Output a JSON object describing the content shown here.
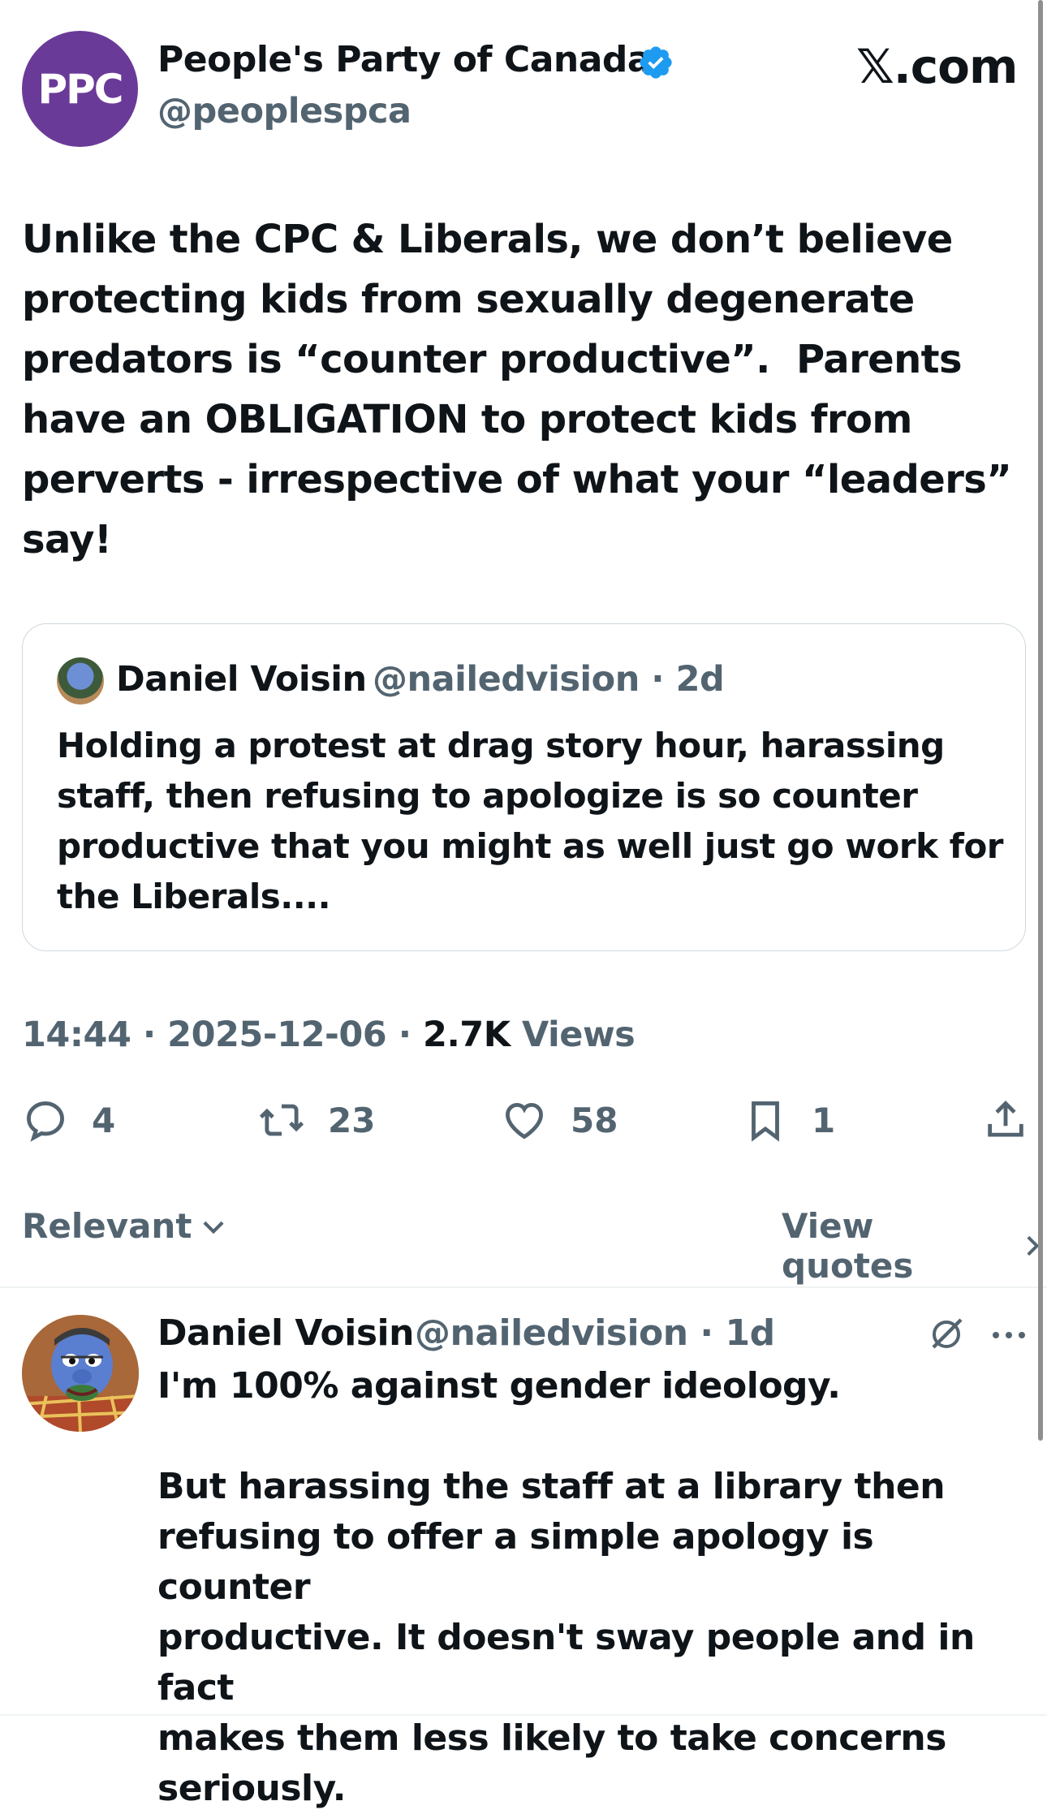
{
  "header": {
    "avatar_text": "PPC",
    "author_name": "People's Party of Canada",
    "handle": "@peoplespca",
    "site": "𝕏.com"
  },
  "tweet": {
    "text": "Unlike the CPC & Liberals, we don’t believe\nprotecting kids from sexually degenerate\npredators is “counter productive”.  Parents\nhave an OBLIGATION to protect kids from\nperverts - irrespective of what your “leaders”\nsay!"
  },
  "quote": {
    "name": "Daniel Voisin",
    "handle_time": "@nailedvision · 2d",
    "text": "Holding a protest at drag story hour, harassing\nstaff, then refusing to apologize is so counter\nproductive that you might as well just go work for\nthe Liberals...."
  },
  "meta": {
    "time": "14:44",
    "date": "2025-12-06",
    "views_count": "2.7K",
    "views_label": "Views"
  },
  "actions": {
    "replies": "4",
    "reposts": "23",
    "likes": "58",
    "bookmarks": "1"
  },
  "sort": {
    "relevant_label": "Relevant",
    "view_quotes_label": "View quotes"
  },
  "reply": {
    "name": "Daniel Voisin",
    "handle_time": "@nailedvision · 1d",
    "text": "I'm 100% against gender ideology.\n\nBut harassing the staff at a library then\nrefusing to offer a simple apology is counter\nproductive. It doesn't sway people and in fact\nmakes them less likely to take concerns\nseriously."
  },
  "colors": {
    "ppc_purple": "#6a3a99",
    "verified_blue": "#1d9bf0",
    "secondary_text": "#536471",
    "primary_text": "#0f1419"
  }
}
